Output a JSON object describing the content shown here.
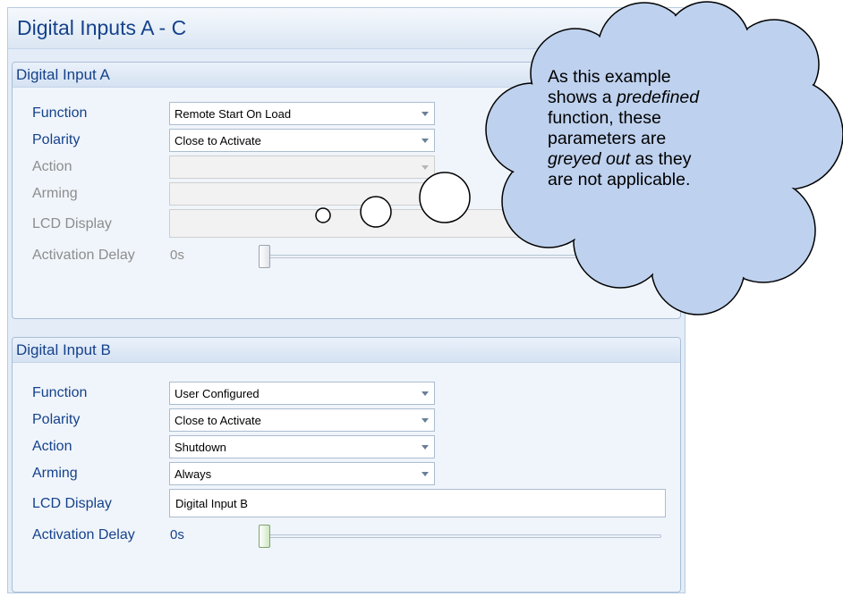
{
  "window": {
    "title": "Digital Inputs A - C"
  },
  "input_a": {
    "header": "Digital Input A",
    "function": {
      "label": "Function",
      "value": "Remote Start On Load"
    },
    "polarity": {
      "label": "Polarity",
      "value": "Close to Activate"
    },
    "action": {
      "label": "Action",
      "value": ""
    },
    "arming": {
      "label": "Arming",
      "value": ""
    },
    "lcd_display": {
      "label": "LCD Display",
      "value": ""
    },
    "activation_delay": {
      "label": "Activation Delay",
      "value": "0s",
      "slider_level": 0
    }
  },
  "input_b": {
    "header": "Digital Input B",
    "function": {
      "label": "Function",
      "value": "User Configured"
    },
    "polarity": {
      "label": "Polarity",
      "value": "Close to Activate"
    },
    "action": {
      "label": "Action",
      "value": "Shutdown"
    },
    "arming": {
      "label": "Arming",
      "value": "Always"
    },
    "lcd_display": {
      "label": "LCD Display",
      "value": "Digital Input B"
    },
    "activation_delay": {
      "label": "Activation Delay",
      "value": "0s",
      "slider_level": 0
    }
  },
  "callout": {
    "line1": "As this example",
    "line2_pre": "shows a ",
    "line2_em": "predefined",
    "line3": "function, these",
    "line4": "parameters are",
    "line5_em": "greyed out",
    "line5_post": " as they",
    "line6": "are not applicable."
  },
  "colors": {
    "label_text": "#15428b",
    "disabled_text": "#8d8d8d",
    "cloud_fill": "#bed1ee",
    "panel_bg": "#e3ecf7"
  },
  "icons": {
    "dropdown": "chevron-down-icon"
  }
}
